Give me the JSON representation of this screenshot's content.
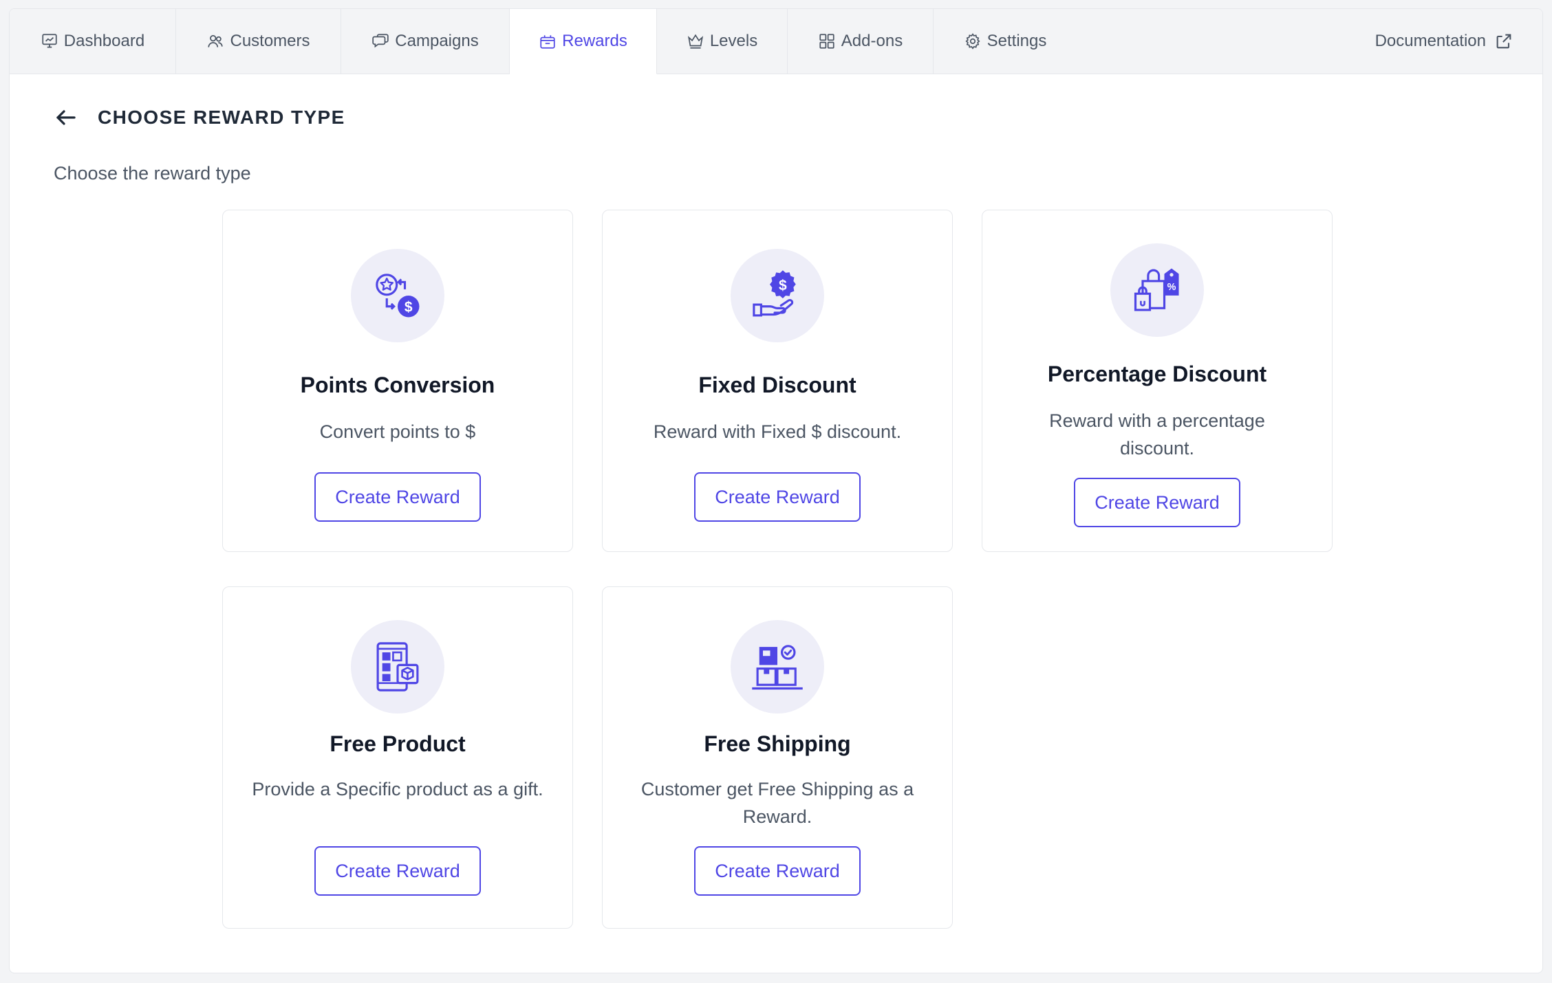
{
  "nav": {
    "tabs": [
      {
        "label": "Dashboard",
        "icon": "presentation-chart-icon"
      },
      {
        "label": "Customers",
        "icon": "users-icon"
      },
      {
        "label": "Campaigns",
        "icon": "chat-bubbles-icon"
      },
      {
        "label": "Rewards",
        "icon": "gift-basket-icon",
        "active": true
      },
      {
        "label": "Levels",
        "icon": "crown-icon"
      },
      {
        "label": "Add-ons",
        "icon": "grid-squares-icon"
      },
      {
        "label": "Settings",
        "icon": "gear-icon"
      }
    ],
    "documentation": "Documentation"
  },
  "page": {
    "title": "CHOOSE REWARD TYPE",
    "subtitle": "Choose the reward type"
  },
  "cards": [
    {
      "title": "Points Conversion",
      "description": "Convert points to $",
      "button": "Create Reward",
      "icon": "points-conversion-icon"
    },
    {
      "title": "Fixed Discount",
      "description": "Reward with Fixed $ discount.",
      "button": "Create Reward",
      "icon": "hand-dollar-icon"
    },
    {
      "title": "Percentage Discount",
      "description": "Reward with a percentage discount.",
      "button": "Create Reward",
      "icon": "shopping-bag-percent-icon"
    },
    {
      "title": "Free Product",
      "description": "Provide a Specific product as a gift.",
      "button": "Create Reward",
      "icon": "phone-gift-icon"
    },
    {
      "title": "Free Shipping",
      "description": "Customer get Free Shipping as a Reward.",
      "button": "Create Reward",
      "icon": "shipping-boxes-icon"
    }
  ],
  "colors": {
    "accent": "#4f46e5",
    "icon_bg": "#eeeef8",
    "nav_bg": "#f3f4f6"
  }
}
